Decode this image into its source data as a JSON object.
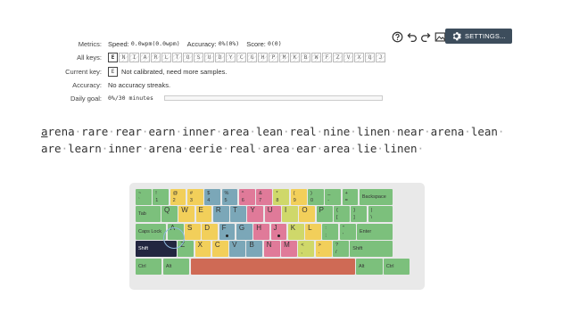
{
  "toolbar": {
    "help_icon": "help-circle-icon",
    "undo_icon": "undo-icon",
    "redo_icon": "redo-icon",
    "image_icon": "image-icon",
    "settings_label": "SETTINGS...",
    "settings_icon": "gear-icon"
  },
  "stats": {
    "metrics_label": "Metrics:",
    "speed_label": "Speed:",
    "speed_value": "0.0wpm(0.0wpm)",
    "accuracy_label": "Accuracy:",
    "accuracy_value": "0%(0%)",
    "score_label": "Score:",
    "score_value": "0(0)",
    "all_keys_label": "All keys:",
    "all_keys": [
      "E",
      "N",
      "I",
      "A",
      "R",
      "L",
      "T",
      "O",
      "S",
      "U",
      "D",
      "Y",
      "C",
      "G",
      "H",
      "P",
      "M",
      "K",
      "B",
      "W",
      "F",
      "Z",
      "V",
      "X",
      "Q",
      "J"
    ],
    "active_key_count": 6,
    "current_key_label": "Current key:",
    "current_key": "E",
    "current_key_status": "Not calibrated, need more samples.",
    "accuracy_row_label": "Accuracy:",
    "accuracy_streaks": "No accuracy streaks.",
    "daily_goal_label": "Daily goal:",
    "daily_goal_value": "0%/30 minutes",
    "daily_goal_progress": 0
  },
  "lesson": {
    "line1": [
      "arena",
      "rare",
      "rear",
      "earn",
      "inner",
      "area",
      "lean",
      "real",
      "nine",
      "linen",
      "near",
      "arena",
      "lean"
    ],
    "line2": [
      "are",
      "learn",
      "inner",
      "arena",
      "eerie",
      "real",
      "area",
      "ear",
      "area",
      "lie",
      "linen"
    ]
  },
  "keyboard": {
    "colors": {
      "pinky": "#7cc07c",
      "ring": "#f2cf5a",
      "middle": "#e07a99",
      "left_index": "#7ba7b8",
      "right_index": "#cfd86a",
      "thumb": "#cf6a55",
      "shift_active": "#232640"
    },
    "rows": [
      [
        {
          "hi": "~",
          "lo": "`",
          "finger": "pinky"
        },
        {
          "hi": "!",
          "lo": "1",
          "finger": "pinky"
        },
        {
          "hi": "@",
          "lo": "2",
          "finger": "ring"
        },
        {
          "hi": "#",
          "lo": "3",
          "finger": "ring"
        },
        {
          "hi": "$",
          "lo": "4",
          "finger": "left_index"
        },
        {
          "hi": "%",
          "lo": "5",
          "finger": "left_index"
        },
        {
          "hi": "^",
          "lo": "6",
          "finger": "middle"
        },
        {
          "hi": "&",
          "lo": "7",
          "finger": "middle"
        },
        {
          "hi": "*",
          "lo": "8",
          "finger": "right_index"
        },
        {
          "hi": "(",
          "lo": "9",
          "finger": "ring"
        },
        {
          "hi": ")",
          "lo": "0",
          "finger": "pinky"
        },
        {
          "hi": "_",
          "lo": "-",
          "finger": "pinky"
        },
        {
          "hi": "+",
          "lo": "=",
          "finger": "pinky"
        },
        {
          "label": "Backspace",
          "finger": "pinky",
          "wide": true
        }
      ],
      [
        {
          "label": "Tab",
          "finger": "pinky",
          "wide": true
        },
        {
          "big": "Q",
          "finger": "pinky"
        },
        {
          "big": "W",
          "finger": "ring"
        },
        {
          "big": "E",
          "finger": "ring"
        },
        {
          "big": "R",
          "finger": "left_index"
        },
        {
          "big": "T",
          "finger": "left_index"
        },
        {
          "big": "Y",
          "finger": "middle"
        },
        {
          "big": "U",
          "finger": "middle"
        },
        {
          "big": "I",
          "finger": "right_index"
        },
        {
          "big": "O",
          "finger": "ring"
        },
        {
          "big": "P",
          "finger": "pinky"
        },
        {
          "hi": "{",
          "lo": "[",
          "finger": "pinky"
        },
        {
          "hi": "}",
          "lo": "]",
          "finger": "pinky"
        },
        {
          "hi": "|",
          "lo": "\\",
          "finger": "pinky",
          "wide": true
        }
      ],
      [
        {
          "label": "Caps Lock",
          "finger": "pinky",
          "wide": true
        },
        {
          "big": "A",
          "finger": "pinky"
        },
        {
          "big": "S",
          "finger": "ring"
        },
        {
          "big": "D",
          "finger": "ring"
        },
        {
          "big": "F",
          "finger": "left_index",
          "bump": true
        },
        {
          "big": "G",
          "finger": "left_index"
        },
        {
          "big": "H",
          "finger": "middle"
        },
        {
          "big": "J",
          "finger": "middle",
          "bump": true
        },
        {
          "big": "K",
          "finger": "right_index"
        },
        {
          "big": "L",
          "finger": "ring"
        },
        {
          "hi": ":",
          "lo": ";",
          "finger": "pinky"
        },
        {
          "hi": "\"",
          "lo": "'",
          "finger": "pinky"
        },
        {
          "label": "Enter",
          "finger": "pinky",
          "wide": true
        }
      ],
      [
        {
          "label": "Shift",
          "finger": "shift_active",
          "wide": true
        },
        {
          "big": "Z",
          "finger": "pinky"
        },
        {
          "big": "X",
          "finger": "ring"
        },
        {
          "big": "C",
          "finger": "ring"
        },
        {
          "big": "V",
          "finger": "left_index"
        },
        {
          "big": "B",
          "finger": "left_index"
        },
        {
          "big": "N",
          "finger": "middle"
        },
        {
          "big": "M",
          "finger": "middle"
        },
        {
          "hi": "<",
          "lo": ",",
          "finger": "right_index"
        },
        {
          "hi": ">",
          "lo": ".",
          "finger": "ring"
        },
        {
          "hi": "?",
          "lo": "/",
          "finger": "pinky"
        },
        {
          "label": "Shift",
          "finger": "pinky",
          "wide": true
        }
      ],
      [
        {
          "label": "Ctrl",
          "finger": "pinky"
        },
        {
          "label": "Alt",
          "finger": "pinky"
        },
        {
          "label": "",
          "finger": "thumb",
          "space": true
        },
        {
          "label": "Alt",
          "finger": "pinky"
        },
        {
          "label": "Ctrl",
          "finger": "pinky"
        }
      ]
    ]
  }
}
